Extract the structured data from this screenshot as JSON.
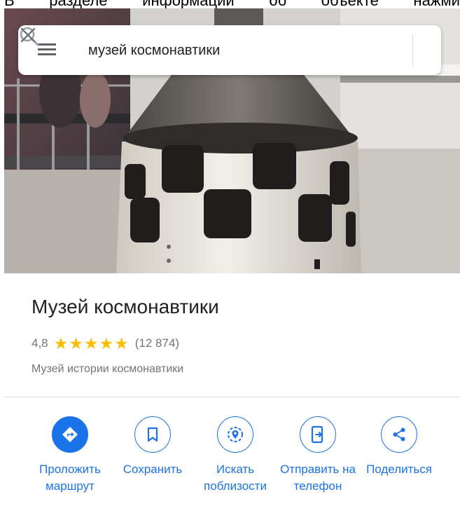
{
  "caption": {
    "words": [
      "В",
      "разделе",
      "информации",
      "об",
      "объекте",
      "нажми"
    ]
  },
  "search": {
    "query": "музей космонавтики"
  },
  "place": {
    "name": "Музей космонавтики",
    "rating": "4,8",
    "stars": "★★★★★",
    "review_count": "(12 874)",
    "category": "Музей истории космонавтики"
  },
  "actions": [
    {
      "label": "Проложить маршрут",
      "icon": "directions-icon"
    },
    {
      "label": "Сохранить",
      "icon": "bookmark-icon"
    },
    {
      "label": "Искать поблизости",
      "icon": "nearby-icon"
    },
    {
      "label": "Отправить на телефон",
      "icon": "send-to-phone-icon"
    },
    {
      "label": "Поделиться",
      "icon": "share-icon"
    }
  ],
  "colors": {
    "accent": "#1a73e8",
    "star": "#fbbc04",
    "secondary_text": "#70757a"
  }
}
